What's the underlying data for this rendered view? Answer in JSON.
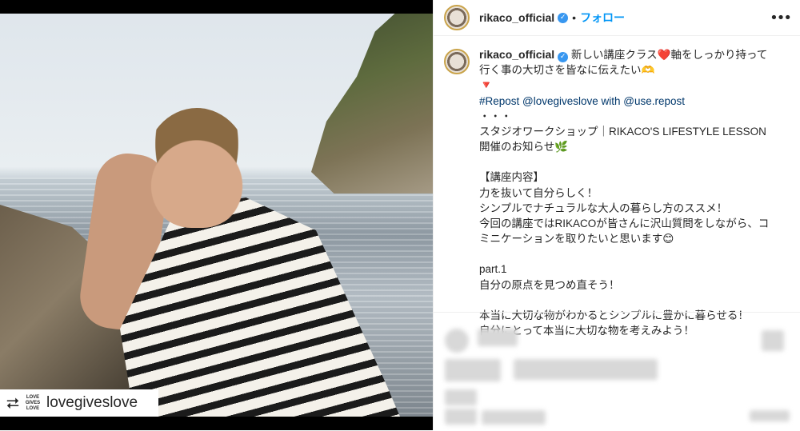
{
  "post_image": {
    "repost_icon": "repost-icon",
    "brand_logo_text": "LOVE GIVES LOVE",
    "repost_account": "lovegiveslove"
  },
  "header": {
    "username": "rikaco_official",
    "separator": "•",
    "follow_label": "フォロー",
    "more_icon": "•••"
  },
  "caption": {
    "username": "rikaco_official",
    "line1": "新しい講座クラス❤️軸をしっかり持って行く事の大切さを皆なに伝えたい🫶",
    "triangle": "🔻",
    "repost_line": "#Repost @lovegiveslove with @use.repost",
    "dots": "・・・",
    "announce": "スタジオワークショップ｜RIKACO'S LIFESTYLE LESSON開催のお知らせ🌿",
    "section_title": "【講座内容】",
    "content1": "力を抜いて自分らしく！",
    "content2": "シンプルでナチュラルな大人の暮らし方のススメ！",
    "content3": "今回の講座ではRIKACOが皆さんに沢山質問をしながら、コミニケーションを取りたいと思います😊",
    "part": "part.1",
    "part_desc": "自分の原点を見つめ直そう！",
    "line_a": "本当に大切な物がわかるとシンプルに豊かに暮らせる！",
    "line_b": "自分にとって本当に大切な物を考えみよう！"
  },
  "colors": {
    "follow": "#0095f6",
    "verified": "#3897f0"
  }
}
